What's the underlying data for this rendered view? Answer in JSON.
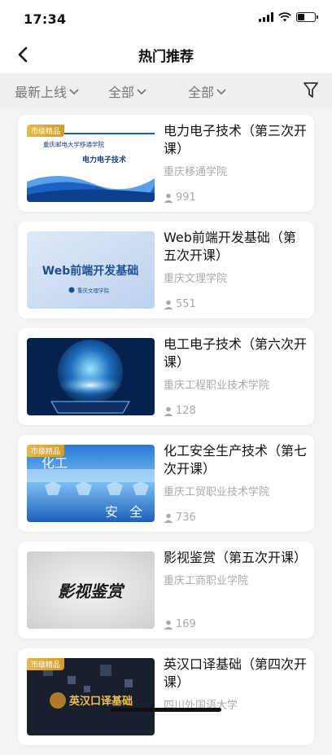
{
  "status": {
    "time": "17:34"
  },
  "nav": {
    "title": "热门推荐"
  },
  "filters": {
    "sort": "最新上线",
    "category": "全部",
    "type": "全部"
  },
  "courses": [
    {
      "title": "电力电子技术（第三次开课）",
      "school": "重庆移通学院",
      "students": "991",
      "badge": "市级精品",
      "thumb_lines": [
        "重庆邮电大学移通学院",
        "电力电子技术"
      ]
    },
    {
      "title": "Web前端开发基础（第五次开课）",
      "school": "重庆文理学院",
      "students": "551",
      "badge": "",
      "thumb_lines": [
        "Web前端开发基础",
        "重庆文理学院"
      ]
    },
    {
      "title": "电工电子技术（第六次开课）",
      "school": "重庆工程职业技术学院",
      "students": "128",
      "badge": "",
      "thumb_lines": []
    },
    {
      "title": "化工安全生产技术（第七次开课）",
      "school": "重庆工贸职业技术学院",
      "students": "736",
      "badge": "市级精品",
      "thumb_lines": [
        "化工",
        "安全"
      ]
    },
    {
      "title": "影视鉴赏（第五次开课）",
      "school": "重庆工商职业学院",
      "students": "169",
      "badge": "",
      "thumb_lines": [
        "影视鉴赏"
      ]
    },
    {
      "title": "英汉口译基础（第四次开课）",
      "school": "四川外国语大学",
      "students": "",
      "badge": "市级精品",
      "thumb_lines": [
        "英汉口译基础"
      ]
    }
  ]
}
